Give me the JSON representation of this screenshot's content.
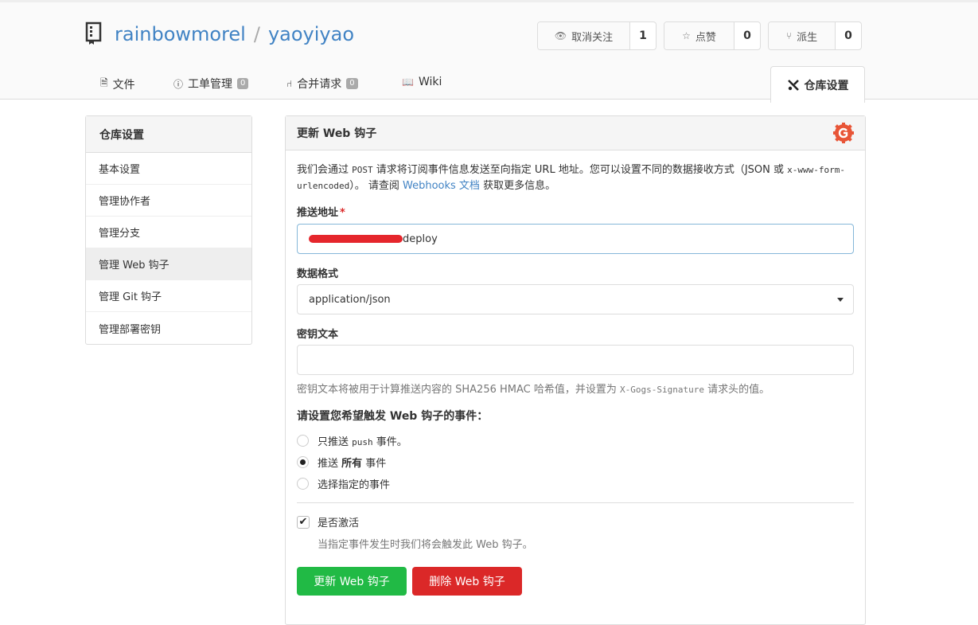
{
  "repo": {
    "owner": "rainbowmorel",
    "separator": "/",
    "name": "yaoyiyao",
    "icon": "repo-book-icon"
  },
  "actions": {
    "watch": {
      "label": "取消关注",
      "count": "1",
      "icon": "eye-icon"
    },
    "star": {
      "label": "点赞",
      "count": "0",
      "icon": "star-icon"
    },
    "fork": {
      "label": "派生",
      "count": "0",
      "icon": "fork-icon"
    }
  },
  "tabs": {
    "files": {
      "label": "文件",
      "icon": "file-text-icon"
    },
    "issues": {
      "label": "工单管理",
      "badge": "0",
      "icon": "issue-opened-icon"
    },
    "pulls": {
      "label": "合并请求",
      "badge": "0",
      "icon": "git-pull-request-icon"
    },
    "wiki": {
      "label": "Wiki",
      "icon": "book-icon"
    },
    "settings": {
      "label": "仓库设置",
      "icon": "tools-icon"
    }
  },
  "sidebar": {
    "title": "仓库设置",
    "items": [
      {
        "label": "基本设置"
      },
      {
        "label": "管理协作者"
      },
      {
        "label": "管理分支"
      },
      {
        "label": "管理 Web 钩子",
        "active": true
      },
      {
        "label": "管理 Git 钩子"
      },
      {
        "label": "管理部署密钥"
      }
    ]
  },
  "form": {
    "title": "更新 Web 钩子",
    "desc_part1": "我们会通过 ",
    "desc_code1": "POST",
    "desc_part2": " 请求将订阅事件信息发送至向指定 URL 地址。您可以设置不同的数据接收方式（JSON 或 ",
    "desc_code2": "x-www-form-urlencoded",
    "desc_part3": "）。 请查阅 ",
    "desc_link": "Webhooks 文档",
    "desc_part4": " 获取更多信息。",
    "url_label": "推送地址",
    "url_required": "*",
    "url_value_visible": "deploy",
    "content_type_label": "数据格式",
    "content_type_value": "application/json",
    "secret_label": "密钥文本",
    "secret_value": "",
    "secret_help_part1": "密钥文本将被用于计算推送内容的 SHA256 HMAC 哈希值，并设置为 ",
    "secret_help_code": "X-Gogs-Signature",
    "secret_help_part2": " 请求头的值。",
    "events_title": "请设置您希望触发 Web 钩子的事件：",
    "events": {
      "push_only": {
        "pre": "只推送 ",
        "code": "push",
        "post": " 事件。",
        "selected": false
      },
      "all": {
        "pre": "推送 ",
        "bold": "所有",
        "post": " 事件",
        "selected": true
      },
      "choose": {
        "label": "选择指定的事件",
        "selected": false
      }
    },
    "active_label": "是否激活",
    "active_checked": true,
    "active_help": "当指定事件发生时我们将会触发此 Web 钩子。",
    "update_button": "更新 Web 钩子",
    "delete_button": "删除 Web 钩子"
  },
  "colors": {
    "link": "#4183c4",
    "green": "#21ba45",
    "red": "#db2828",
    "gogs": "#e85537"
  }
}
